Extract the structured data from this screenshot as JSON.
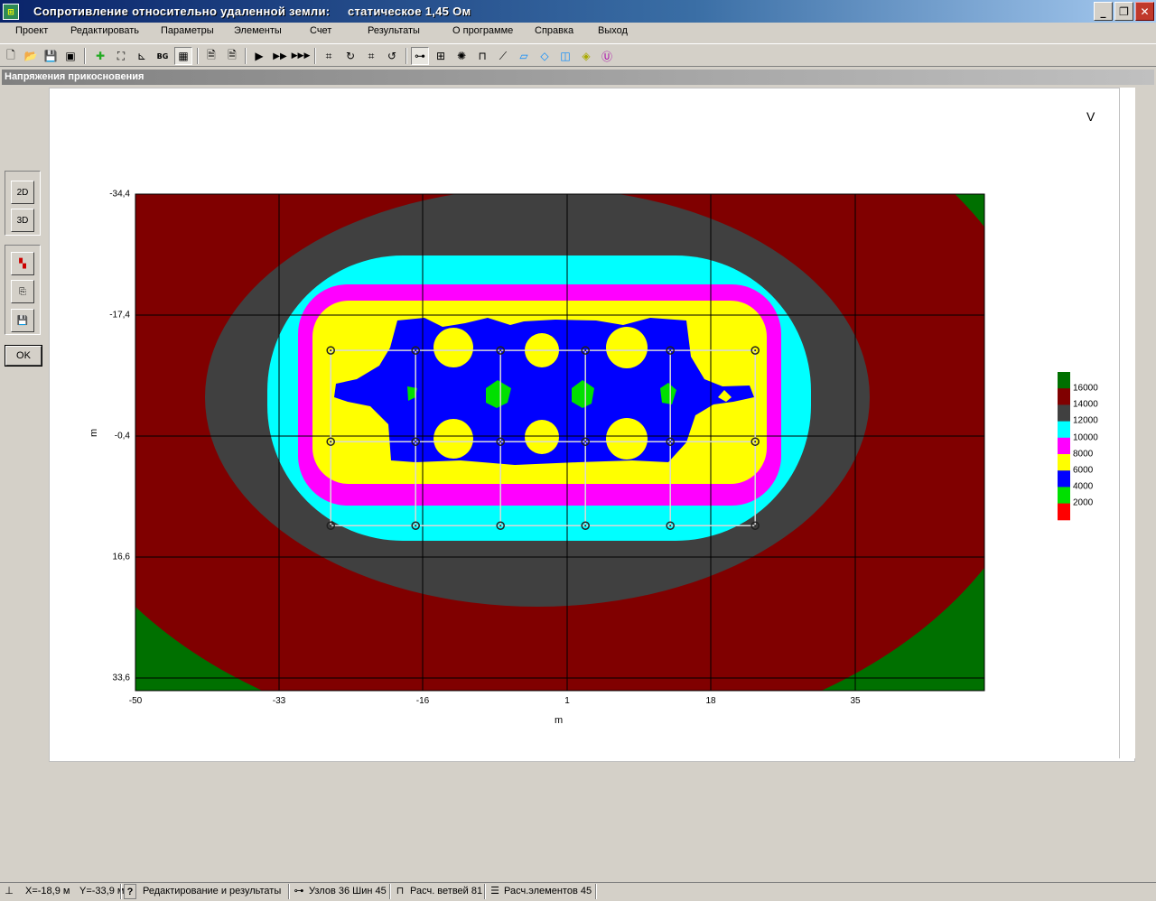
{
  "window": {
    "title": "Сопротивление относительно удаленной земли:     статическое 1,45 Ом",
    "minimize": "_",
    "restore": "❐",
    "close": "✕"
  },
  "menu": [
    "Проект",
    "Редактировать",
    "Параметры",
    "Элементы",
    "Счет",
    "Результаты",
    "О программе",
    "Справка",
    "Выход"
  ],
  "toolbar_icons": [
    "new-file-icon",
    "open-folder-icon",
    "save-icon",
    "save-as-icon",
    "add-node-icon",
    "select-region-icon",
    "axes-icon",
    "bg-icon",
    "grid-icon",
    "document-icon",
    "document-edit-icon",
    "run-icon",
    "run-step-icon",
    "run-all-icon",
    "node-edit-icon",
    "rotate-icon",
    "node-move-icon",
    "rotate-node-icon",
    "branch-icon",
    "mesh-icon",
    "star-icon",
    "bracket-icon",
    "rod-icon",
    "plate-icon",
    "box-icon",
    "cube-icon",
    "voltage-source-icon",
    "u-icon"
  ],
  "toolbar": {
    "bg_label": "BG"
  },
  "panel": {
    "title": "Напряжения прикосновения"
  },
  "side": {
    "btn_2d": "2D",
    "btn_3d": "3D",
    "ok": "OK"
  },
  "plot": {
    "unit": "V",
    "xlabel": "m",
    "ylabel": "m",
    "x_ticks": [
      "-50",
      "-33",
      "-16",
      "1",
      "18",
      "35"
    ],
    "y_ticks": [
      "-34,4",
      "-17,4",
      "-0,4",
      "16,6",
      "33,6"
    ]
  },
  "legend": {
    "labels": [
      "16000",
      "14000",
      "12000",
      "10000",
      "8000",
      "6000",
      "4000",
      "2000"
    ],
    "colors": [
      "#007000",
      "#800000",
      "#404040",
      "#00ffff",
      "#ff00ff",
      "#ffff00",
      "#0000ff",
      "#00e000",
      "#ff0000"
    ]
  },
  "chart_data": {
    "type": "heatmap",
    "title": "",
    "xlabel": "m",
    "ylabel": "m",
    "unit": "V",
    "xlim": [
      -50,
      50
    ],
    "ylim": [
      -34.4,
      33.6
    ],
    "x_ticks": [
      -50,
      -33,
      -16,
      1,
      18,
      35
    ],
    "y_ticks": [
      -34.4,
      -17.4,
      -0.4,
      16.6,
      33.6
    ],
    "color_levels": [
      2000,
      4000,
      6000,
      8000,
      10000,
      12000,
      14000,
      16000
    ],
    "grid": true,
    "legend_position": "right",
    "grid_nodes_x": [
      -27,
      -17,
      -7,
      3,
      13,
      23
    ],
    "grid_nodes_y": [
      -13,
      -0.5,
      11
    ]
  },
  "status": {
    "x": "X=-18,9 м",
    "y": "Y=-33,9 м",
    "help": "?",
    "mode": "Редактирование и результаты",
    "nodes": "Узлов 36 Шин 45",
    "branches": "Расч. ветвей 81",
    "elements": "Расч.элементов 45"
  }
}
